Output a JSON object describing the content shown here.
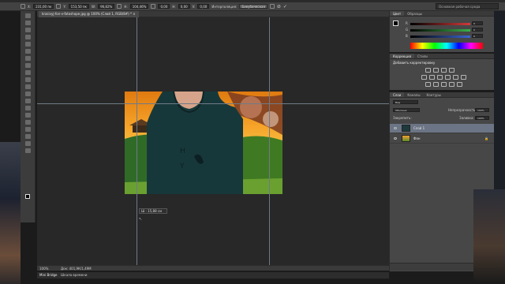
{
  "options_bar": {
    "x_value": "231,00 пк",
    "y_value": "153,50 пк",
    "w_value": "96,82%",
    "h_value": "104,46%",
    "angle_value": "0,00",
    "hskew_value": "0,00",
    "vskew_value": "0,00",
    "interpolation_label": "Интерполяция:",
    "interpolation_value": "Бикубическая",
    "workspace_value": "Основная рабочая среда"
  },
  "document": {
    "tab_title": "krasivyj-fon-v-fotoshope.jpg @ 100% (Слой 1, RGB/8#) *",
    "measure_readout": "Ш : 15,88 см",
    "zoom": "100%",
    "doc_info": "Док: 401,9К/1,49М"
  },
  "mini_bridge": {
    "tab_label": "Mini Bridge",
    "timeline_label": "Шкала времени"
  },
  "color_panel": {
    "tabs": [
      "Цвет",
      "Образцы"
    ],
    "sliders": [
      {
        "label": "R",
        "value": "0",
        "color": "#d23a3a"
      },
      {
        "label": "G",
        "value": "0",
        "color": "#3ab24a"
      },
      {
        "label": "B",
        "value": "0",
        "color": "#3a66d2"
      }
    ]
  },
  "corrections_panel": {
    "tabs": [
      "Коррекция",
      "Стили"
    ],
    "subtitle": "Добавить корректировку"
  },
  "layers_panel": {
    "tabs": [
      "Слои",
      "Каналы",
      "Контуры"
    ],
    "kind_label": "Вид",
    "blend_mode": "Обычные",
    "opacity_label": "Непрозрачность:",
    "opacity_value": "100%",
    "lock_label": "Закрепить:",
    "fill_label": "Заливка:",
    "fill_value": "100%",
    "layers": [
      {
        "name": "Слой 1",
        "selected": true
      },
      {
        "name": "Фон",
        "selected": false
      }
    ]
  }
}
